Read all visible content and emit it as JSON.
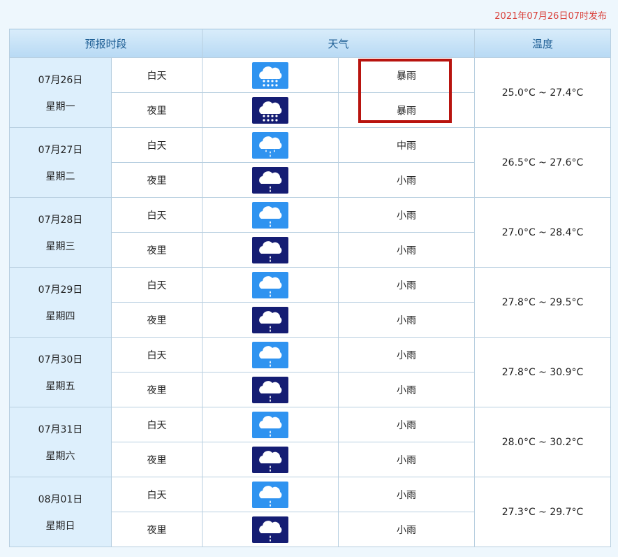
{
  "publish_time": "2021年07月26日07时发布",
  "headers": {
    "period": "预报时段",
    "weather": "天气",
    "temp": "温度"
  },
  "days": [
    {
      "date": "07月26日",
      "weekday": "星期一",
      "day_label": "白天",
      "night_label": "夜里",
      "day_weather": "暴雨",
      "night_weather": "暴雨",
      "day_icon": "heavy-rain-icon",
      "night_icon": "heavy-rain-icon",
      "temp": "25.0°C ~ 27.4°C"
    },
    {
      "date": "07月27日",
      "weekday": "星期二",
      "day_label": "白天",
      "night_label": "夜里",
      "day_weather": "中雨",
      "night_weather": "小雨",
      "day_icon": "moderate-rain-icon",
      "night_icon": "light-rain-icon",
      "temp": "26.5°C ~ 27.6°C"
    },
    {
      "date": "07月28日",
      "weekday": "星期三",
      "day_label": "白天",
      "night_label": "夜里",
      "day_weather": "小雨",
      "night_weather": "小雨",
      "day_icon": "light-rain-icon",
      "night_icon": "light-rain-icon",
      "temp": "27.0°C ~ 28.4°C"
    },
    {
      "date": "07月29日",
      "weekday": "星期四",
      "day_label": "白天",
      "night_label": "夜里",
      "day_weather": "小雨",
      "night_weather": "小雨",
      "day_icon": "light-rain-icon",
      "night_icon": "light-rain-icon",
      "temp": "27.8°C ~ 29.5°C"
    },
    {
      "date": "07月30日",
      "weekday": "星期五",
      "day_label": "白天",
      "night_label": "夜里",
      "day_weather": "小雨",
      "night_weather": "小雨",
      "day_icon": "light-rain-icon",
      "night_icon": "light-rain-icon",
      "temp": "27.8°C ~ 30.9°C"
    },
    {
      "date": "07月31日",
      "weekday": "星期六",
      "day_label": "白天",
      "night_label": "夜里",
      "day_weather": "小雨",
      "night_weather": "小雨",
      "day_icon": "light-rain-icon",
      "night_icon": "light-rain-icon",
      "temp": "28.0°C ~ 30.2°C"
    },
    {
      "date": "08月01日",
      "weekday": "星期日",
      "day_label": "白天",
      "night_label": "夜里",
      "day_weather": "小雨",
      "night_weather": "小雨",
      "day_icon": "light-rain-icon",
      "night_icon": "light-rain-icon",
      "temp": "27.3°C ~ 29.7°C"
    }
  ],
  "colors": {
    "day_icon_bg": "#2f93f0",
    "night_icon_bg": "#151d73",
    "highlight": "#b8140f",
    "publish": "#d9413b"
  }
}
